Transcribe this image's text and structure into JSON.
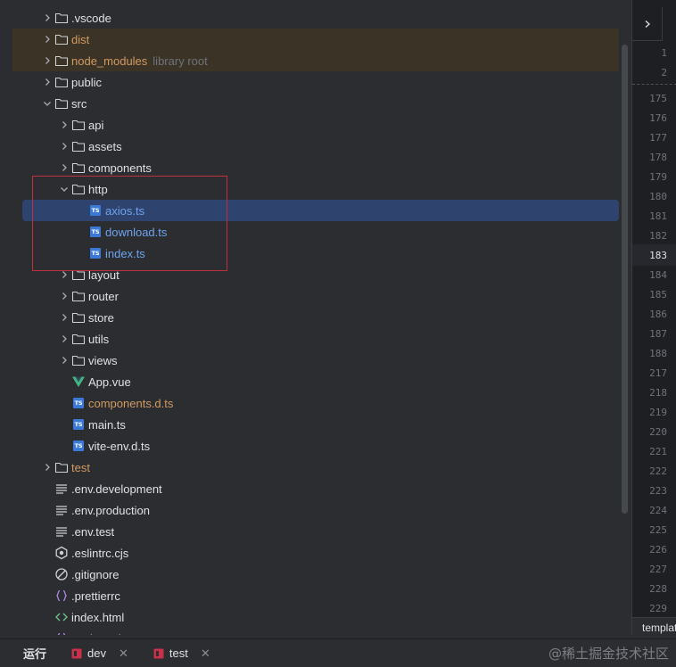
{
  "project_tree": {
    "rows": [
      {
        "label": ".vscode",
        "hint": "",
        "icon": "folder-icon",
        "depth": 0,
        "expander": "collapsed",
        "color": "default",
        "state": "normal"
      },
      {
        "label": "dist",
        "hint": "",
        "icon": "folder-icon",
        "depth": 0,
        "expander": "collapsed",
        "color": "orange",
        "state": "excluded"
      },
      {
        "label": "node_modules",
        "hint": "library root",
        "icon": "folder-icon",
        "depth": 0,
        "expander": "collapsed",
        "color": "orange",
        "state": "excluded"
      },
      {
        "label": "public",
        "hint": "",
        "icon": "folder-icon",
        "depth": 0,
        "expander": "collapsed",
        "color": "default",
        "state": "normal"
      },
      {
        "label": "src",
        "hint": "",
        "icon": "folder-icon",
        "depth": 0,
        "expander": "expanded",
        "color": "default",
        "state": "normal"
      },
      {
        "label": "api",
        "hint": "",
        "icon": "folder-icon",
        "depth": 1,
        "expander": "collapsed",
        "color": "default",
        "state": "normal"
      },
      {
        "label": "assets",
        "hint": "",
        "icon": "folder-icon",
        "depth": 1,
        "expander": "collapsed",
        "color": "default",
        "state": "normal"
      },
      {
        "label": "components",
        "hint": "",
        "icon": "folder-icon",
        "depth": 1,
        "expander": "collapsed",
        "color": "default",
        "state": "normal"
      },
      {
        "label": "http",
        "hint": "",
        "icon": "folder-icon",
        "depth": 1,
        "expander": "expanded",
        "color": "default",
        "state": "normal"
      },
      {
        "label": "axios.ts",
        "hint": "",
        "icon": "typescript-file-icon",
        "depth": 2,
        "expander": "none",
        "color": "blue",
        "state": "selected"
      },
      {
        "label": "download.ts",
        "hint": "",
        "icon": "typescript-file-icon",
        "depth": 2,
        "expander": "none",
        "color": "blue",
        "state": "normal"
      },
      {
        "label": "index.ts",
        "hint": "",
        "icon": "typescript-file-icon",
        "depth": 2,
        "expander": "none",
        "color": "blue",
        "state": "normal"
      },
      {
        "label": "layout",
        "hint": "",
        "icon": "folder-icon",
        "depth": 1,
        "expander": "collapsed",
        "color": "default",
        "state": "normal"
      },
      {
        "label": "router",
        "hint": "",
        "icon": "folder-icon",
        "depth": 1,
        "expander": "collapsed",
        "color": "default",
        "state": "normal"
      },
      {
        "label": "store",
        "hint": "",
        "icon": "folder-icon",
        "depth": 1,
        "expander": "collapsed",
        "color": "default",
        "state": "normal"
      },
      {
        "label": "utils",
        "hint": "",
        "icon": "folder-icon",
        "depth": 1,
        "expander": "collapsed",
        "color": "default",
        "state": "normal"
      },
      {
        "label": "views",
        "hint": "",
        "icon": "folder-icon",
        "depth": 1,
        "expander": "collapsed",
        "color": "default",
        "state": "normal"
      },
      {
        "label": "App.vue",
        "hint": "",
        "icon": "vue-file-icon",
        "depth": 1,
        "expander": "none",
        "color": "default",
        "state": "normal"
      },
      {
        "label": "components.d.ts",
        "hint": "",
        "icon": "typescript-file-icon",
        "depth": 1,
        "expander": "none",
        "color": "orange",
        "state": "normal"
      },
      {
        "label": "main.ts",
        "hint": "",
        "icon": "typescript-file-icon",
        "depth": 1,
        "expander": "none",
        "color": "default",
        "state": "normal"
      },
      {
        "label": "vite-env.d.ts",
        "hint": "",
        "icon": "typescript-file-icon",
        "depth": 1,
        "expander": "none",
        "color": "default",
        "state": "normal"
      },
      {
        "label": "test",
        "hint": "",
        "icon": "folder-icon",
        "depth": 0,
        "expander": "collapsed",
        "color": "orange",
        "state": "normal"
      },
      {
        "label": ".env.development",
        "hint": "",
        "icon": "text-file-icon",
        "depth": 0,
        "expander": "none",
        "color": "default",
        "state": "normal"
      },
      {
        "label": ".env.production",
        "hint": "",
        "icon": "text-file-icon",
        "depth": 0,
        "expander": "none",
        "color": "default",
        "state": "normal"
      },
      {
        "label": ".env.test",
        "hint": "",
        "icon": "text-file-icon",
        "depth": 0,
        "expander": "none",
        "color": "default",
        "state": "normal"
      },
      {
        "label": ".eslintrc.cjs",
        "hint": "",
        "icon": "eslint-icon",
        "depth": 0,
        "expander": "none",
        "color": "default",
        "state": "normal"
      },
      {
        "label": ".gitignore",
        "hint": "",
        "icon": "ignore-file-icon",
        "depth": 0,
        "expander": "none",
        "color": "default",
        "state": "normal"
      },
      {
        "label": ".prettierrc",
        "hint": "",
        "icon": "json-braces-icon",
        "depth": 0,
        "expander": "none",
        "color": "default",
        "state": "normal"
      },
      {
        "label": "index.html",
        "hint": "",
        "icon": "html-file-icon",
        "depth": 0,
        "expander": "none",
        "color": "default",
        "state": "normal"
      },
      {
        "label": "package.json",
        "hint": "",
        "icon": "json-braces-icon",
        "depth": 0,
        "expander": "none",
        "color": "default",
        "state": "normal"
      }
    ]
  },
  "gutter": {
    "line_numbers": [
      "1",
      "2",
      "175",
      "176",
      "177",
      "178",
      "179",
      "180",
      "181",
      "182",
      "183",
      "184",
      "185",
      "186",
      "187",
      "188",
      "217",
      "218",
      "219",
      "220",
      "221",
      "222",
      "223",
      "224",
      "225",
      "226",
      "227",
      "228",
      "229"
    ],
    "current_line": "183",
    "breadcrumb": "template"
  },
  "run_bar": {
    "title": "运行",
    "tabs": [
      {
        "label": "dev"
      },
      {
        "label": "test"
      }
    ],
    "close_glyph": "✕"
  },
  "watermark": "@稀土掘金技术社区",
  "colors": {
    "selection": "#2e436e",
    "excluded_row": "#3a3326",
    "highlight_border": "#c0303e",
    "orange_text": "#d29a61",
    "blue_text": "#6ea4f0"
  }
}
